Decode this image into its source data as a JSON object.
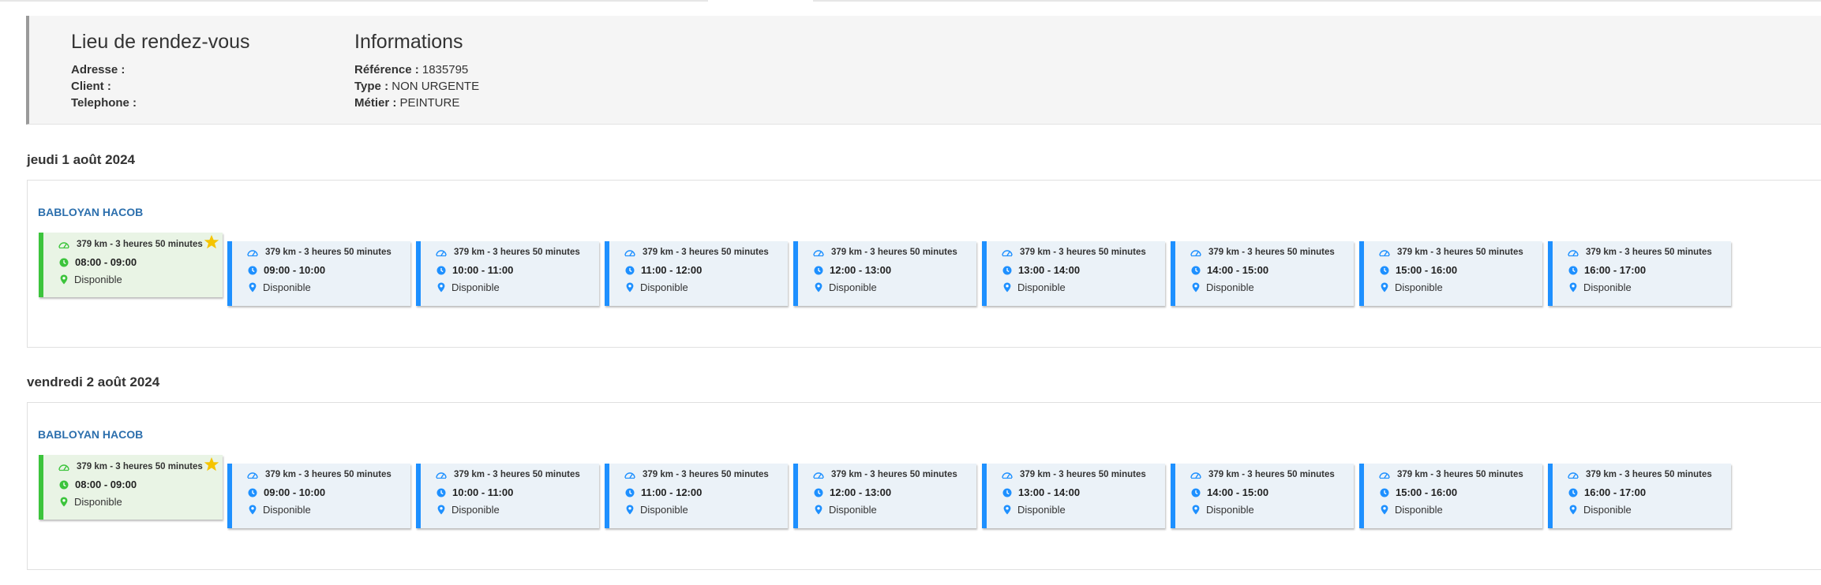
{
  "header": {
    "location": {
      "title": "Lieu de rendez-vous",
      "fields": [
        {
          "label": "Adresse :",
          "value": ""
        },
        {
          "label": "Client :",
          "value": ""
        },
        {
          "label": "Telephone :",
          "value": ""
        }
      ]
    },
    "info": {
      "title": "Informations",
      "fields": [
        {
          "label": "Référence :",
          "value": " 1835795"
        },
        {
          "label": "Type :",
          "value": " NON URGENTE"
        },
        {
          "label": "Métier :",
          "value": " PEINTURE"
        }
      ]
    }
  },
  "colors": {
    "best": "#3cc43c",
    "normal": "#1e90ff",
    "tech": "#2c6fad",
    "star": "#f5c400"
  },
  "days": [
    {
      "date": "jeudi 1 août 2024",
      "technician": "BABLOYAN HACOB",
      "slots": [
        {
          "distance": "379 km - 3 heures 50 minutes",
          "time": "08:00 - 09:00",
          "status": "Disponible",
          "best": true
        },
        {
          "distance": "379 km - 3 heures 50 minutes",
          "time": "09:00 - 10:00",
          "status": "Disponible",
          "best": false
        },
        {
          "distance": "379 km - 3 heures 50 minutes",
          "time": "10:00 - 11:00",
          "status": "Disponible",
          "best": false
        },
        {
          "distance": "379 km - 3 heures 50 minutes",
          "time": "11:00 - 12:00",
          "status": "Disponible",
          "best": false
        },
        {
          "distance": "379 km - 3 heures 50 minutes",
          "time": "12:00 - 13:00",
          "status": "Disponible",
          "best": false
        },
        {
          "distance": "379 km - 3 heures 50 minutes",
          "time": "13:00 - 14:00",
          "status": "Disponible",
          "best": false
        },
        {
          "distance": "379 km - 3 heures 50 minutes",
          "time": "14:00 - 15:00",
          "status": "Disponible",
          "best": false
        },
        {
          "distance": "379 km - 3 heures 50 minutes",
          "time": "15:00 - 16:00",
          "status": "Disponible",
          "best": false
        },
        {
          "distance": "379 km - 3 heures 50 minutes",
          "time": "16:00 - 17:00",
          "status": "Disponible",
          "best": false
        }
      ]
    },
    {
      "date": "vendredi 2 août 2024",
      "technician": "BABLOYAN HACOB",
      "slots": [
        {
          "distance": "379 km - 3 heures 50 minutes",
          "time": "08:00 - 09:00",
          "status": "Disponible",
          "best": true
        },
        {
          "distance": "379 km - 3 heures 50 minutes",
          "time": "09:00 - 10:00",
          "status": "Disponible",
          "best": false
        },
        {
          "distance": "379 km - 3 heures 50 minutes",
          "time": "10:00 - 11:00",
          "status": "Disponible",
          "best": false
        },
        {
          "distance": "379 km - 3 heures 50 minutes",
          "time": "11:00 - 12:00",
          "status": "Disponible",
          "best": false
        },
        {
          "distance": "379 km - 3 heures 50 minutes",
          "time": "12:00 - 13:00",
          "status": "Disponible",
          "best": false
        },
        {
          "distance": "379 km - 3 heures 50 minutes",
          "time": "13:00 - 14:00",
          "status": "Disponible",
          "best": false
        },
        {
          "distance": "379 km - 3 heures 50 minutes",
          "time": "14:00 - 15:00",
          "status": "Disponible",
          "best": false
        },
        {
          "distance": "379 km - 3 heures 50 minutes",
          "time": "15:00 - 16:00",
          "status": "Disponible",
          "best": false
        },
        {
          "distance": "379 km - 3 heures 50 minutes",
          "time": "16:00 - 17:00",
          "status": "Disponible",
          "best": false
        }
      ]
    }
  ]
}
